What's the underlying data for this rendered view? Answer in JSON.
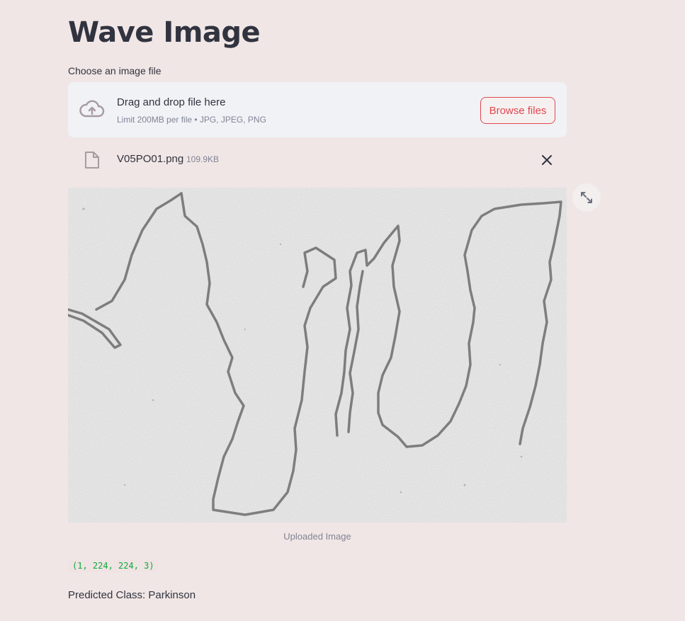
{
  "page": {
    "title": "Wave Image"
  },
  "uploader": {
    "label": "Choose an image file",
    "drop_text": "Drag and drop file here",
    "limit_text": "Limit 200MB per file • JPG, JPEG, PNG",
    "browse_label": "Browse files",
    "icon": "cloud-upload-icon"
  },
  "file": {
    "name": "V05PO01.png",
    "size": "109.9KB",
    "icon": "file-icon",
    "remove_icon": "close-icon"
  },
  "image": {
    "caption": "Uploaded Image",
    "fullscreen_icon": "expand-icon"
  },
  "output": {
    "shape": "(1, 224, 224, 3)",
    "prediction": "Predicted Class: Parkinson"
  },
  "colors": {
    "background": "#f0e6e5",
    "accent": "#e0474d",
    "code_text": "#09ab3b",
    "text": "#31333f",
    "muted": "#808495"
  }
}
